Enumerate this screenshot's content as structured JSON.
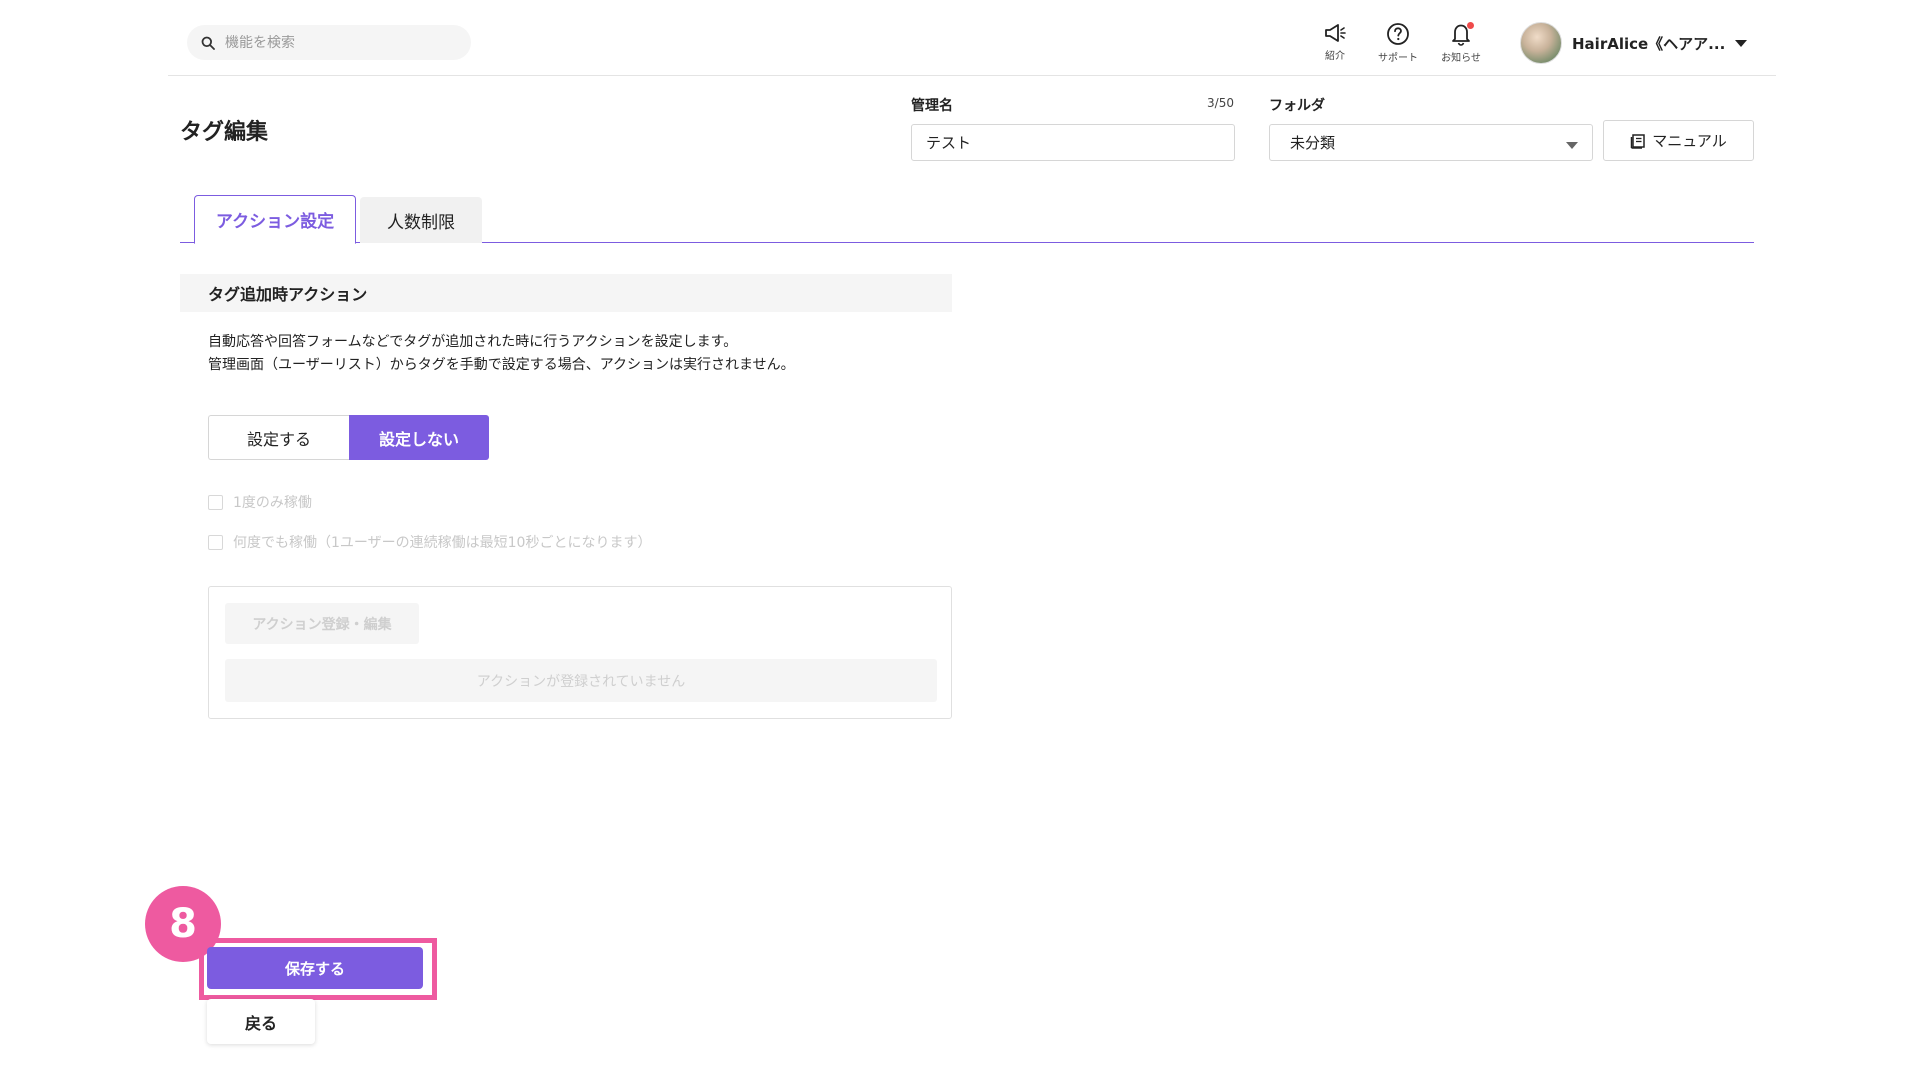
{
  "header": {
    "search": {
      "placeholder": "機能を検索",
      "value": ""
    },
    "icons": [
      {
        "name": "megaphone-icon",
        "label": "紹介"
      },
      {
        "name": "help-icon",
        "label": "サポート"
      },
      {
        "name": "bell-icon",
        "label": "お知らせ",
        "has_notification": true
      }
    ],
    "user": {
      "name": "HairAlice《ヘアア..."
    }
  },
  "page": {
    "title": "タグ編集",
    "management_name": {
      "label": "管理名",
      "value": "テスト",
      "count": "3/50"
    },
    "folder": {
      "label": "フォルダ",
      "value": "未分類"
    },
    "manual_label": "マニュアル"
  },
  "tabs": [
    {
      "label": "アクション設定",
      "active": true
    },
    {
      "label": "人数制限",
      "active": false
    }
  ],
  "section": {
    "title": "タグ追加時アクション",
    "description": [
      "自動応答や回答フォームなどでタグが追加された時に行うアクションを設定します。",
      "管理画面（ユーザーリスト）からタグを手動で設定する場合、アクションは実行されません。"
    ],
    "toggle": {
      "set_label": "設定する",
      "unset_label": "設定しない",
      "selected": "設定しない"
    },
    "options": [
      {
        "label": "1度のみ稼働",
        "checked": false,
        "disabled": true
      },
      {
        "label": "何度でも稼働（1ユーザーの連続稼働は最短10秒ごとになります）",
        "checked": false,
        "disabled": true
      }
    ],
    "action_edit_label": "アクション登録・編集",
    "empty_message": "アクションが登録されていません"
  },
  "footer": {
    "step_number": "8",
    "save_label": "保存する",
    "back_label": "戻る"
  },
  "colors": {
    "accent": "#7c5ce0",
    "highlight": "#ee5aa0",
    "notification": "#ef4a4a"
  }
}
